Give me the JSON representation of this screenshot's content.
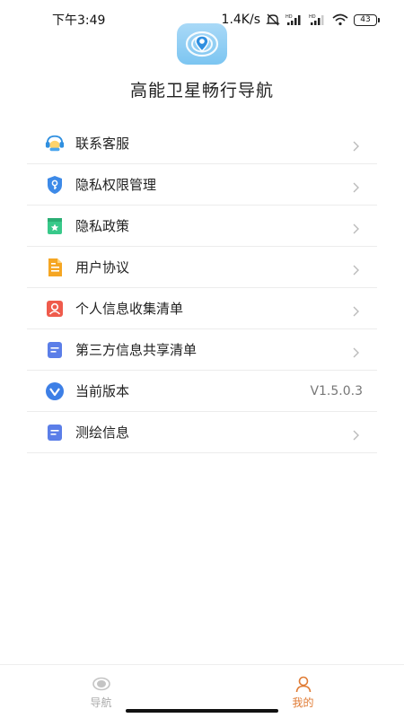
{
  "status_bar": {
    "time": "下午3:49",
    "net_speed": "1.4K/s",
    "battery": "43"
  },
  "header": {
    "app_title": "高能卫星畅行导航"
  },
  "menu": {
    "items": [
      {
        "label": "联系客服",
        "icon": "customer-service-icon"
      },
      {
        "label": "隐私权限管理",
        "icon": "shield-key-icon"
      },
      {
        "label": "隐私政策",
        "icon": "bookmark-star-icon"
      },
      {
        "label": "用户协议",
        "icon": "document-icon"
      },
      {
        "label": "个人信息收集清单",
        "icon": "user-card-icon"
      },
      {
        "label": "第三方信息共享清单",
        "icon": "list-doc-icon"
      },
      {
        "label": "当前版本",
        "icon": "version-v-icon",
        "value": "V1.5.0.3"
      },
      {
        "label": "测绘信息",
        "icon": "list-doc-icon"
      }
    ]
  },
  "bottom_nav": {
    "nav_label": "导航",
    "mine_label": "我的",
    "active_color": "#e07b34",
    "inactive_color": "#aaaaaa"
  }
}
